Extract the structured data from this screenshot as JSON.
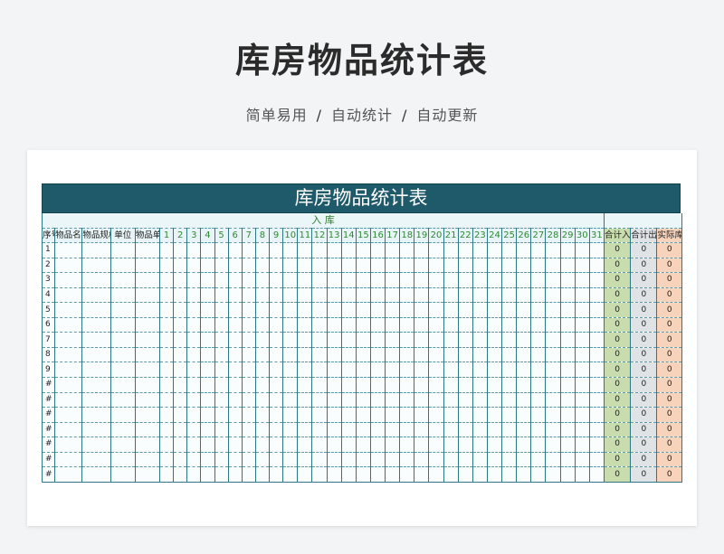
{
  "page": {
    "title": "库房物品统计表",
    "subtitle_parts": [
      "简单易用",
      "自动统计",
      "自动更新"
    ],
    "separator": "/"
  },
  "sheet": {
    "banner": "库房物品统计表",
    "inbound_label": "入    库",
    "headers": {
      "seq": "序号",
      "name": "物品名称",
      "spec": "物品规格",
      "unit": "单位",
      "price": "物品单价",
      "days": [
        "1",
        "2",
        "3",
        "4",
        "5",
        "6",
        "7",
        "8",
        "9",
        "10",
        "11",
        "12",
        "13",
        "14",
        "15",
        "16",
        "17",
        "18",
        "19",
        "20",
        "21",
        "22",
        "23",
        "24",
        "25",
        "26",
        "27",
        "28",
        "29",
        "30",
        "31"
      ],
      "total_in": "合计入库",
      "total_out": "合计出库",
      "actual_stock": "实际库存"
    },
    "rows": [
      {
        "index": "1",
        "total_in": "0",
        "total_out": "0",
        "actual_stock": "0"
      },
      {
        "index": "2",
        "total_in": "0",
        "total_out": "0",
        "actual_stock": "0"
      },
      {
        "index": "3",
        "total_in": "0",
        "total_out": "0",
        "actual_stock": "0"
      },
      {
        "index": "4",
        "total_in": "0",
        "total_out": "0",
        "actual_stock": "0"
      },
      {
        "index": "5",
        "total_in": "0",
        "total_out": "0",
        "actual_stock": "0"
      },
      {
        "index": "6",
        "total_in": "0",
        "total_out": "0",
        "actual_stock": "0"
      },
      {
        "index": "7",
        "total_in": "0",
        "total_out": "0",
        "actual_stock": "0"
      },
      {
        "index": "8",
        "total_in": "0",
        "total_out": "0",
        "actual_stock": "0"
      },
      {
        "index": "9",
        "total_in": "0",
        "total_out": "0",
        "actual_stock": "0"
      },
      {
        "index": "#",
        "total_in": "0",
        "total_out": "0",
        "actual_stock": "0"
      },
      {
        "index": "#",
        "total_in": "0",
        "total_out": "0",
        "actual_stock": "0"
      },
      {
        "index": "#",
        "total_in": "0",
        "total_out": "0",
        "actual_stock": "0"
      },
      {
        "index": "#",
        "total_in": "0",
        "total_out": "0",
        "actual_stock": "0"
      },
      {
        "index": "#",
        "total_in": "0",
        "total_out": "0",
        "actual_stock": "0"
      },
      {
        "index": "#",
        "total_in": "0",
        "total_out": "0",
        "actual_stock": "0"
      },
      {
        "index": "#",
        "total_in": "0",
        "total_out": "0",
        "actual_stock": "0"
      }
    ],
    "colors": {
      "banner": "#1f5a6a",
      "total_in": "#c8dcae",
      "total_out": "#dfe3e6",
      "actual_stock": "#f8d3bb",
      "day_header_text": "#2f8a32"
    }
  }
}
